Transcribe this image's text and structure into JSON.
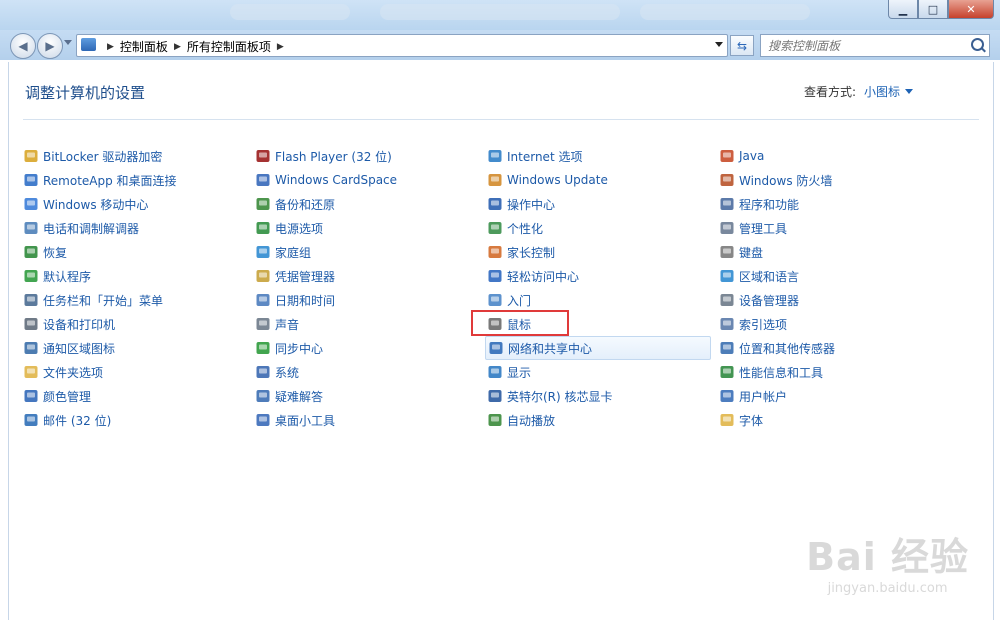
{
  "window": {
    "min_glyph": "▁",
    "max_glyph": "□",
    "close_glyph": "✕"
  },
  "nav": {
    "back_glyph": "◀",
    "forward_glyph": "▶",
    "breadcrumbs": [
      "控制面板",
      "所有控制面板项"
    ],
    "separator": "▶",
    "search_placeholder": "搜索控制面板"
  },
  "content": {
    "heading": "调整计算机的设置",
    "view_label": "查看方式:",
    "view_value": "小图标"
  },
  "columns": [
    [
      {
        "label": "BitLocker 驱动器加密",
        "icon": "bitlocker-icon",
        "color": "#d8a528"
      },
      {
        "label": "RemoteApp 和桌面连接",
        "icon": "remoteapp-icon",
        "color": "#2f6fc7"
      },
      {
        "label": "Windows 移动中心",
        "icon": "mobility-center-icon",
        "color": "#3b7dd8"
      },
      {
        "label": "电话和调制解调器",
        "icon": "phone-modem-icon",
        "color": "#4c7fb8"
      },
      {
        "label": "恢复",
        "icon": "recovery-icon",
        "color": "#2d8a3a"
      },
      {
        "label": "默认程序",
        "icon": "default-programs-icon",
        "color": "#2f9b3e"
      },
      {
        "label": "任务栏和「开始」菜单",
        "icon": "taskbar-icon",
        "color": "#4a6b91"
      },
      {
        "label": "设备和打印机",
        "icon": "printer-icon",
        "color": "#5f6b7a"
      },
      {
        "label": "通知区域图标",
        "icon": "notification-icon",
        "color": "#3a6ea8"
      },
      {
        "label": "文件夹选项",
        "icon": "folder-options-icon",
        "color": "#e0b548"
      },
      {
        "label": "颜色管理",
        "icon": "color-management-icon",
        "color": "#3168b8"
      },
      {
        "label": "邮件 (32 位)",
        "icon": "mail-icon",
        "color": "#2f6fb7"
      }
    ],
    [
      {
        "label": "Flash Player (32 位)",
        "icon": "flash-icon",
        "color": "#9b1c1c"
      },
      {
        "label": "Windows CardSpace",
        "icon": "cardspace-icon",
        "color": "#3568b9"
      },
      {
        "label": "备份和还原",
        "icon": "backup-icon",
        "color": "#3a8a3a"
      },
      {
        "label": "电源选项",
        "icon": "power-icon",
        "color": "#2f8f3f"
      },
      {
        "label": "家庭组",
        "icon": "homegroup-icon",
        "color": "#2f8bd0"
      },
      {
        "label": "凭据管理器",
        "icon": "credential-icon",
        "color": "#c7a23a"
      },
      {
        "label": "日期和时间",
        "icon": "datetime-icon",
        "color": "#4b7cbd"
      },
      {
        "label": "声音",
        "icon": "sound-icon",
        "color": "#6d7a88"
      },
      {
        "label": "同步中心",
        "icon": "sync-icon",
        "color": "#2e9b3c"
      },
      {
        "label": "系统",
        "icon": "system-icon",
        "color": "#3a68b0"
      },
      {
        "label": "疑难解答",
        "icon": "troubleshoot-icon",
        "color": "#3b6eb3"
      },
      {
        "label": "桌面小工具",
        "icon": "gadgets-icon",
        "color": "#3a6ab8"
      }
    ],
    [
      {
        "label": "Internet 选项",
        "icon": "internet-options-icon",
        "color": "#2f7ec7"
      },
      {
        "label": "Windows Update",
        "icon": "windows-update-icon",
        "color": "#d18a2a"
      },
      {
        "label": "操作中心",
        "icon": "action-center-icon",
        "color": "#2a5fb0"
      },
      {
        "label": "个性化",
        "icon": "personalize-icon",
        "color": "#3a8f4a"
      },
      {
        "label": "家长控制",
        "icon": "parental-icon",
        "color": "#d36b2a"
      },
      {
        "label": "轻松访问中心",
        "icon": "ease-of-access-icon",
        "color": "#2d68c0"
      },
      {
        "label": "入门",
        "icon": "getting-started-icon",
        "color": "#4b86c8"
      },
      {
        "label": "鼠标",
        "icon": "mouse-icon",
        "color": "#6a6a6a"
      },
      {
        "label": "网络和共享中心",
        "icon": "network-icon",
        "color": "#2f6cb8"
      },
      {
        "label": "显示",
        "icon": "display-icon",
        "color": "#2f7ac2"
      },
      {
        "label": "英特尔(R) 核芯显卡",
        "icon": "intel-graphics-icon",
        "color": "#2a5aa0"
      },
      {
        "label": "自动播放",
        "icon": "autoplay-icon",
        "color": "#3a8a3a"
      }
    ],
    [
      {
        "label": "Java",
        "icon": "java-icon",
        "color": "#c84c2a"
      },
      {
        "label": "Windows 防火墙",
        "icon": "firewall-icon",
        "color": "#b8532a"
      },
      {
        "label": "程序和功能",
        "icon": "programs-icon",
        "color": "#4a6ba0"
      },
      {
        "label": "管理工具",
        "icon": "admin-tools-icon",
        "color": "#6a7b92"
      },
      {
        "label": "键盘",
        "icon": "keyboard-icon",
        "color": "#7a7a7a"
      },
      {
        "label": "区域和语言",
        "icon": "region-icon",
        "color": "#2f8bd0"
      },
      {
        "label": "设备管理器",
        "icon": "device-manager-icon",
        "color": "#6d7a88"
      },
      {
        "label": "索引选项",
        "icon": "indexing-icon",
        "color": "#5a7aa8"
      },
      {
        "label": "位置和其他传感器",
        "icon": "sensor-icon",
        "color": "#3a6fb0"
      },
      {
        "label": "性能信息和工具",
        "icon": "performance-icon",
        "color": "#2f8a3f"
      },
      {
        "label": "用户帐户",
        "icon": "user-accounts-icon",
        "color": "#3a6fb8"
      },
      {
        "label": "字体",
        "icon": "fonts-icon",
        "color": "#e0b548"
      }
    ]
  ],
  "watermark": {
    "brand": "Bai 经验",
    "url": "jingyan.baidu.com"
  }
}
